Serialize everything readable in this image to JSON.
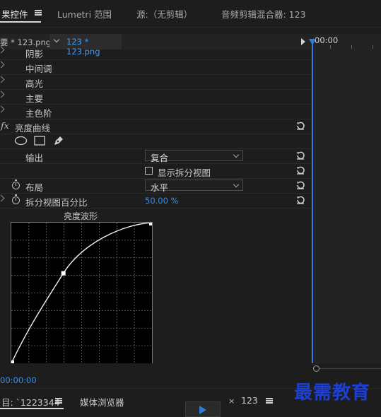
{
  "tabs": {
    "effect_controls": "果控件",
    "lumetri_scopes": "Lumetri 范围",
    "source": "源:（无剪辑）",
    "audio_mixer": "音频剪辑混合器: 123"
  },
  "clip_header": {
    "master": "要 * 123.png",
    "clip": "123 * 123.png",
    "timecode": "00:00"
  },
  "properties": {
    "shadows": "阴影",
    "midtones": "中间调",
    "highlights": "高光",
    "master": "主要",
    "primary_levels": "主色阶",
    "fx": "fx",
    "luma_curve": "亮度曲线",
    "output_label": "输出",
    "output_value": "复合",
    "split_view_label": "显示拆分视图",
    "layout_label": "布局",
    "layout_value": "水平",
    "split_percent_label": "拆分视图百分比",
    "split_percent_value": "50.00 %",
    "waveform_title": "亮度波形"
  },
  "curve": {
    "control_point": [
      0.37,
      0.64
    ]
  },
  "bottom": {
    "timecode": "00:00:00",
    "project_tab": "目: `1223344",
    "media_browser": "媒体浏览器",
    "close_x": "×",
    "sequence": "123"
  },
  "watermark": "最需教育",
  "colors": {
    "accent": "#2f7bd9",
    "watermark": "#1f3fd1",
    "value_blue": "#3d8ee6"
  }
}
